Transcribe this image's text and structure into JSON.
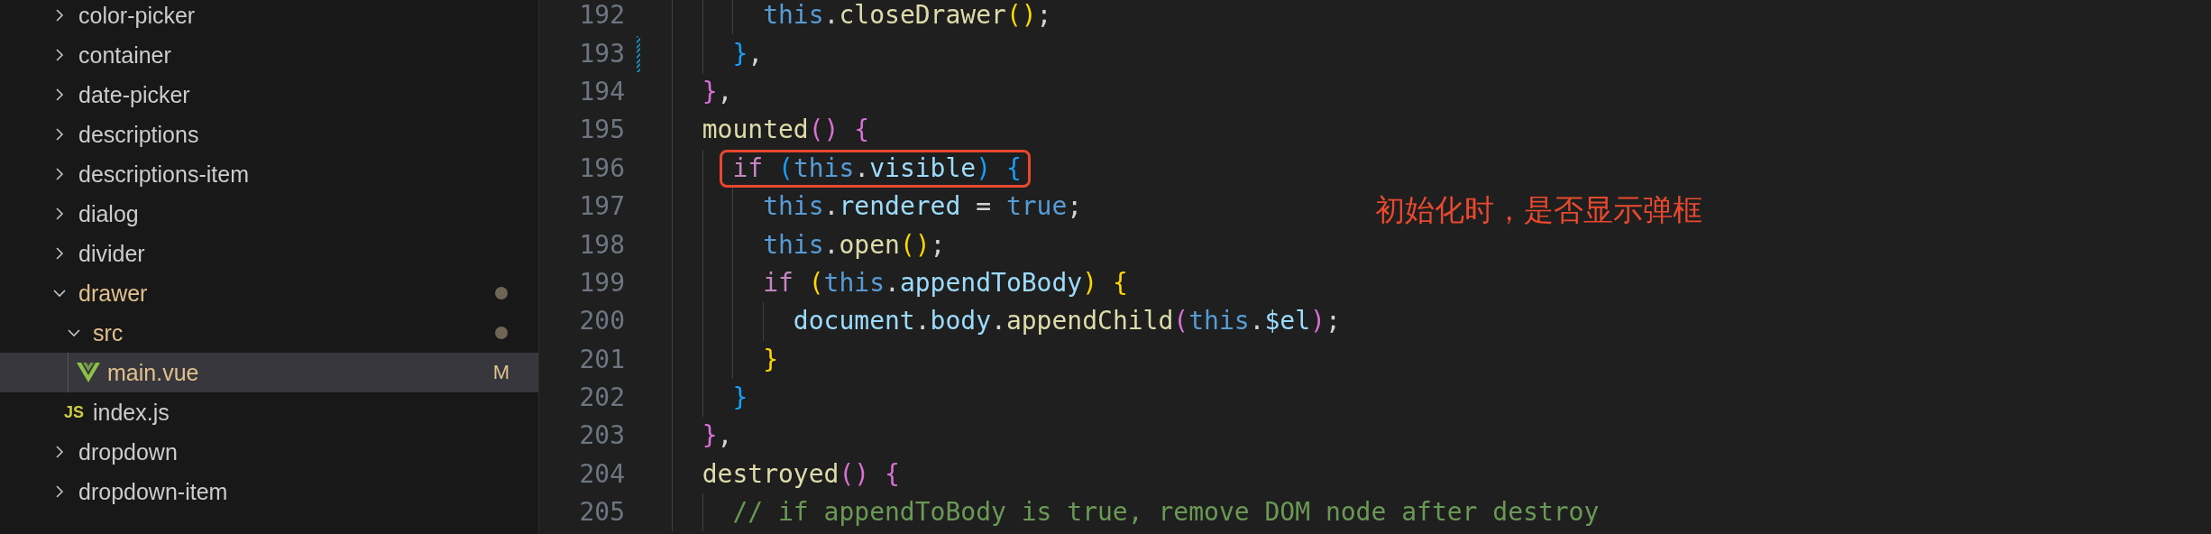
{
  "explorer": {
    "items": [
      {
        "name": "color-picker",
        "kind": "folder",
        "expanded": false,
        "selected": false,
        "modified": false
      },
      {
        "name": "container",
        "kind": "folder",
        "expanded": false,
        "selected": false,
        "modified": false
      },
      {
        "name": "date-picker",
        "kind": "folder",
        "expanded": false,
        "selected": false,
        "modified": false
      },
      {
        "name": "descriptions",
        "kind": "folder",
        "expanded": false,
        "selected": false,
        "modified": false
      },
      {
        "name": "descriptions-item",
        "kind": "folder",
        "expanded": false,
        "selected": false,
        "modified": false
      },
      {
        "name": "dialog",
        "kind": "folder",
        "expanded": false,
        "selected": false,
        "modified": false
      },
      {
        "name": "divider",
        "kind": "folder",
        "expanded": false,
        "selected": false,
        "modified": false
      },
      {
        "name": "drawer",
        "kind": "folder",
        "expanded": true,
        "selected": false,
        "modified": true,
        "children": [
          {
            "name": "src",
            "kind": "folder",
            "expanded": true,
            "selected": false,
            "modified": true,
            "children": [
              {
                "name": "main.vue",
                "kind": "vue",
                "selected": true,
                "modified": true,
                "badge": "M"
              }
            ]
          },
          {
            "name": "index.js",
            "kind": "js",
            "icon_text": "JS",
            "selected": false,
            "modified": false
          }
        ]
      },
      {
        "name": "dropdown",
        "kind": "folder",
        "expanded": false,
        "selected": false,
        "modified": false
      },
      {
        "name": "dropdown-item",
        "kind": "folder",
        "expanded": false,
        "selected": false,
        "modified": false
      }
    ]
  },
  "editor": {
    "lines": [
      {
        "number": "192",
        "modified": false,
        "annotated": false,
        "tokens": [
          {
            "kind": "this",
            "text": "      this"
          },
          {
            "kind": "plain",
            "text": "."
          },
          {
            "kind": "fn",
            "text": "closeDrawer"
          },
          {
            "kind": "b1",
            "text": "()"
          },
          {
            "kind": "plain",
            "text": ";"
          }
        ]
      },
      {
        "number": "193",
        "modified": true,
        "annotated": false,
        "tokens": [
          {
            "kind": "b3",
            "text": "    }"
          },
          {
            "kind": "plain",
            "text": ","
          }
        ]
      },
      {
        "number": "194",
        "modified": false,
        "annotated": false,
        "tokens": [
          {
            "kind": "b2",
            "text": "  }"
          },
          {
            "kind": "plain",
            "text": ","
          }
        ]
      },
      {
        "number": "195",
        "modified": false,
        "annotated": false,
        "tokens": [
          {
            "kind": "fn",
            "text": "  mounted"
          },
          {
            "kind": "b2",
            "text": "() {"
          }
        ]
      },
      {
        "number": "196",
        "modified": false,
        "annotated": true,
        "tokens": [
          {
            "kind": "kw",
            "text": "    if "
          },
          {
            "kind": "b3",
            "text": "("
          },
          {
            "kind": "this",
            "text": "this"
          },
          {
            "kind": "plain",
            "text": "."
          },
          {
            "kind": "prop",
            "text": "visible"
          },
          {
            "kind": "b3",
            "text": ") {"
          }
        ]
      },
      {
        "number": "197",
        "modified": false,
        "annotated": false,
        "tokens": [
          {
            "kind": "this",
            "text": "      this"
          },
          {
            "kind": "plain",
            "text": "."
          },
          {
            "kind": "prop",
            "text": "rendered"
          },
          {
            "kind": "plain",
            "text": " = "
          },
          {
            "kind": "bool",
            "text": "true"
          },
          {
            "kind": "plain",
            "text": ";"
          }
        ]
      },
      {
        "number": "198",
        "modified": false,
        "annotated": false,
        "tokens": [
          {
            "kind": "this",
            "text": "      this"
          },
          {
            "kind": "plain",
            "text": "."
          },
          {
            "kind": "fn",
            "text": "open"
          },
          {
            "kind": "b1",
            "text": "()"
          },
          {
            "kind": "plain",
            "text": ";"
          }
        ]
      },
      {
        "number": "199",
        "modified": false,
        "annotated": false,
        "tokens": [
          {
            "kind": "kw",
            "text": "      if "
          },
          {
            "kind": "b1",
            "text": "("
          },
          {
            "kind": "this",
            "text": "this"
          },
          {
            "kind": "plain",
            "text": "."
          },
          {
            "kind": "prop",
            "text": "appendToBody"
          },
          {
            "kind": "b1",
            "text": ") {"
          }
        ]
      },
      {
        "number": "200",
        "modified": false,
        "annotated": false,
        "tokens": [
          {
            "kind": "prop",
            "text": "        document"
          },
          {
            "kind": "plain",
            "text": "."
          },
          {
            "kind": "prop",
            "text": "body"
          },
          {
            "kind": "plain",
            "text": "."
          },
          {
            "kind": "fn",
            "text": "appendChild"
          },
          {
            "kind": "b2",
            "text": "("
          },
          {
            "kind": "this",
            "text": "this"
          },
          {
            "kind": "plain",
            "text": "."
          },
          {
            "kind": "prop",
            "text": "$el"
          },
          {
            "kind": "b2",
            "text": ")"
          },
          {
            "kind": "plain",
            "text": ";"
          }
        ]
      },
      {
        "number": "201",
        "modified": false,
        "annotated": false,
        "tokens": [
          {
            "kind": "b1",
            "text": "      }"
          }
        ]
      },
      {
        "number": "202",
        "modified": false,
        "annotated": false,
        "tokens": [
          {
            "kind": "b3",
            "text": "    }"
          }
        ]
      },
      {
        "number": "203",
        "modified": false,
        "annotated": false,
        "tokens": [
          {
            "kind": "b2",
            "text": "  }"
          },
          {
            "kind": "plain",
            "text": ","
          }
        ]
      },
      {
        "number": "204",
        "modified": false,
        "annotated": false,
        "tokens": [
          {
            "kind": "fn",
            "text": "  destroyed"
          },
          {
            "kind": "b2",
            "text": "() {"
          }
        ]
      },
      {
        "number": "205",
        "modified": false,
        "annotated": false,
        "tokens": [
          {
            "kind": "comment",
            "text": "    // if appendToBody is true, remove DOM node after destroy"
          }
        ]
      }
    ],
    "annotation": "初始化时，是否显示弹框"
  }
}
